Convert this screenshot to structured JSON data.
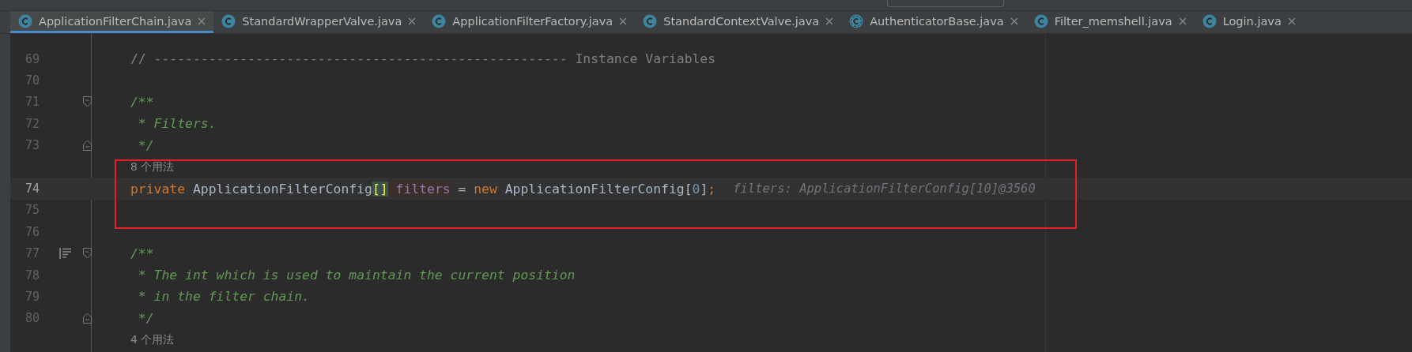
{
  "tabs": [
    {
      "label": "ApplicationFilterChain.java",
      "selected": true,
      "kind": "class"
    },
    {
      "label": "StandardWrapperValve.java",
      "selected": false,
      "kind": "class"
    },
    {
      "label": "ApplicationFilterFactory.java",
      "selected": false,
      "kind": "class"
    },
    {
      "label": "StandardContextValve.java",
      "selected": false,
      "kind": "class"
    },
    {
      "label": "AuthenticatorBase.java",
      "selected": false,
      "kind": "abstract"
    },
    {
      "label": "Filter_memshell.java",
      "selected": false,
      "kind": "class"
    },
    {
      "label": "Login.java",
      "selected": false,
      "kind": "class"
    }
  ],
  "editor": {
    "rows": [
      {
        "kind": "code",
        "number": "69",
        "tokens": [
          {
            "text": "// ----------------------------------------------------- Instance Variables",
            "kind": "comment"
          }
        ]
      },
      {
        "kind": "code",
        "number": "70"
      },
      {
        "kind": "code",
        "number": "71",
        "gutter": [
          {
            "kind": "fold-start"
          }
        ],
        "tokens": [
          {
            "text": "/**",
            "kind": "doc"
          }
        ]
      },
      {
        "kind": "code",
        "number": "72",
        "tokens": [
          {
            "text": " * Filters.",
            "kind": "doc"
          }
        ]
      },
      {
        "kind": "code",
        "number": "73",
        "gutter": [
          {
            "kind": "fold-end"
          }
        ],
        "tokens": [
          {
            "text": " */",
            "kind": "doc"
          }
        ]
      },
      {
        "kind": "usages",
        "text": "8 个用法",
        "boxed": true
      },
      {
        "kind": "code",
        "number": "74",
        "current": true,
        "boxed": true,
        "tokens": [
          {
            "text": "private ",
            "kind": "keyword"
          },
          {
            "text": "ApplicationFilterConfig",
            "kind": "plain"
          },
          {
            "text": "[]",
            "kind": "brace-match"
          },
          {
            "text": " filters",
            "kind": "field"
          },
          {
            "text": " = ",
            "kind": "plain"
          },
          {
            "text": "new",
            "kind": "keyword"
          },
          {
            "text": " ApplicationFilterConfig[",
            "kind": "plain"
          },
          {
            "text": "0",
            "kind": "number"
          },
          {
            "text": "]",
            "kind": "plain"
          },
          {
            "text": ";",
            "kind": "keyword"
          }
        ],
        "hint": "filters: ApplicationFilterConfig[10]@3560"
      },
      {
        "kind": "code",
        "number": "75",
        "boxed": true
      },
      {
        "kind": "code",
        "number": "76"
      },
      {
        "kind": "code",
        "number": "77",
        "gutter": [
          {
            "kind": "render-doc"
          },
          {
            "kind": "fold-start"
          }
        ],
        "tokens": [
          {
            "text": "/**",
            "kind": "doc"
          }
        ]
      },
      {
        "kind": "code",
        "number": "78",
        "tokens": [
          {
            "text": " * The int which is used to maintain the current position",
            "kind": "doc"
          }
        ]
      },
      {
        "kind": "code",
        "number": "79",
        "tokens": [
          {
            "text": " * in the filter chain.",
            "kind": "doc"
          }
        ]
      },
      {
        "kind": "code",
        "number": "80",
        "gutter": [
          {
            "kind": "fold-end"
          }
        ],
        "tokens": [
          {
            "text": " */",
            "kind": "doc"
          }
        ]
      },
      {
        "kind": "usages",
        "text": "4 个用法"
      }
    ]
  }
}
